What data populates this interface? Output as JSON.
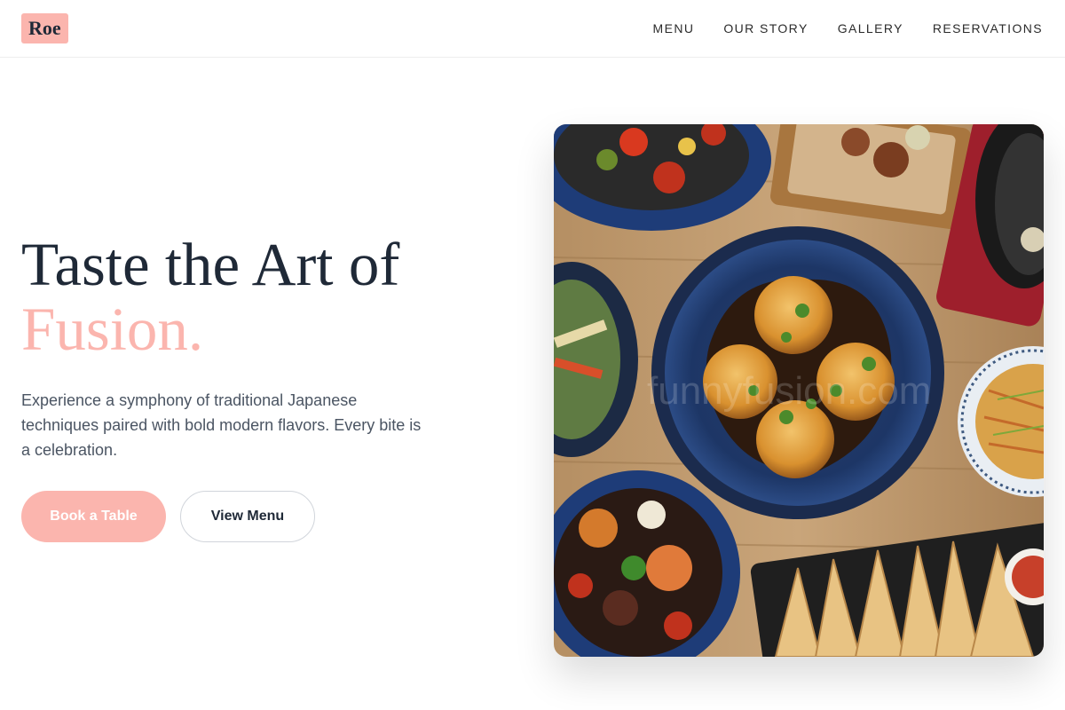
{
  "brand": {
    "logo_text": "Roe",
    "accent_color": "#fbb5ae"
  },
  "nav": {
    "items": [
      {
        "label": "MENU"
      },
      {
        "label": "OUR STORY"
      },
      {
        "label": "GALLERY"
      },
      {
        "label": "RESERVATIONS"
      }
    ]
  },
  "hero": {
    "title_line1": "Taste the Art of",
    "title_line2": "Fusion.",
    "description": "Experience a symphony of traditional Japanese techniques paired with bold modern flavors. Every bite is a celebration.",
    "primary_cta": "Book a Table",
    "secondary_cta": "View Menu",
    "image_watermark": "funnyfusion.com"
  }
}
